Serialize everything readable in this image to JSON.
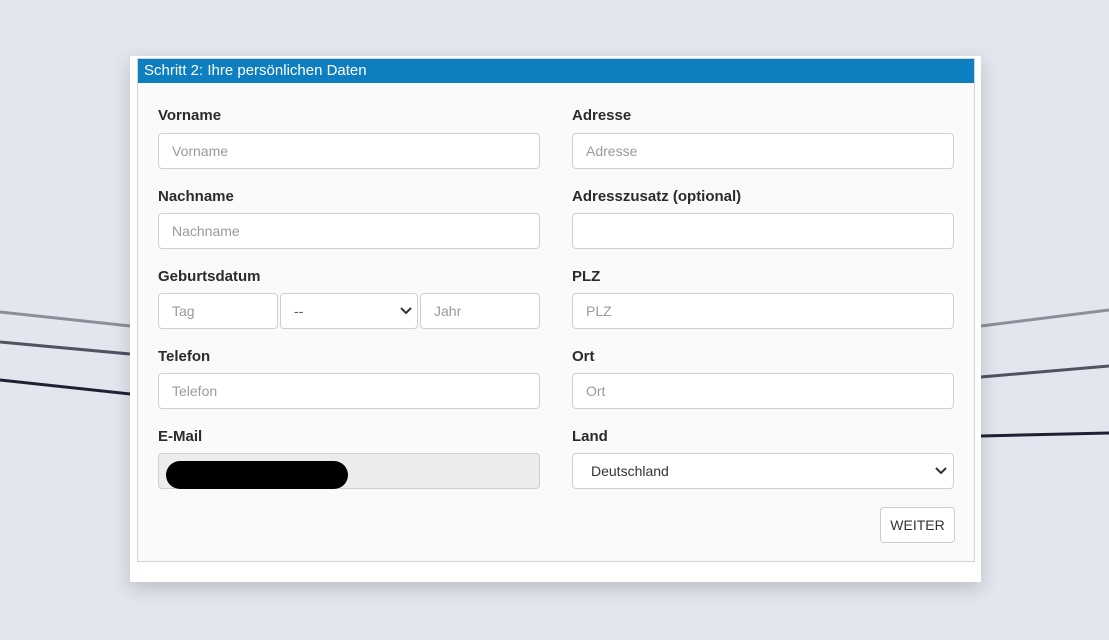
{
  "panel": {
    "title": "Schritt 2: Ihre persönlichen Daten"
  },
  "fields": {
    "vorname": {
      "label": "Vorname",
      "placeholder": "Vorname"
    },
    "nachname": {
      "label": "Nachname",
      "placeholder": "Nachname"
    },
    "geburtsdatum": {
      "label": "Geburtsdatum",
      "day_placeholder": "Tag",
      "month_value": "--",
      "year_placeholder": "Jahr"
    },
    "telefon": {
      "label": "Telefon",
      "placeholder": "Telefon"
    },
    "email": {
      "label": "E-Mail",
      "value_redacted": true
    },
    "adresse": {
      "label": "Adresse",
      "placeholder": "Adresse"
    },
    "adresszusatz": {
      "label": "Adresszusatz (optional)",
      "placeholder": ""
    },
    "plz": {
      "label": "PLZ",
      "placeholder": "PLZ"
    },
    "ort": {
      "label": "Ort",
      "placeholder": "Ort"
    },
    "land": {
      "label": "Land",
      "value": "Deutschland"
    }
  },
  "actions": {
    "next_label": "WEITER"
  },
  "colors": {
    "header": "#0d7ebf",
    "background": "#e3e6ee",
    "redaction": "#000000"
  },
  "icons": {
    "select_arrow": "chevron-down-icon"
  }
}
